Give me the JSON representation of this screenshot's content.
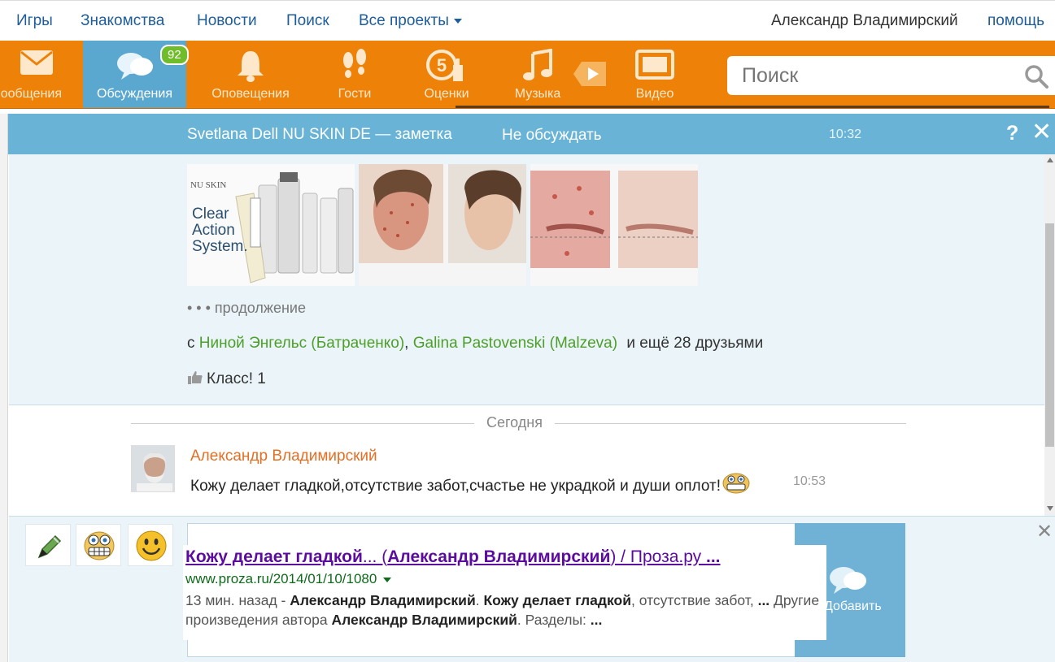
{
  "nav": {
    "links": [
      "Игры",
      "Знакомства",
      "Новости",
      "Поиск",
      "Все проекты"
    ],
    "user": "Александр Владимирский",
    "help": "помощь"
  },
  "toolbar": {
    "items": [
      {
        "label": "ообщения",
        "icon": "envelope-icon"
      },
      {
        "label": "Обсуждения",
        "icon": "chat-bubbles-icon",
        "badge": "92",
        "active": true
      },
      {
        "label": "Оповещения",
        "icon": "bell-icon"
      },
      {
        "label": "Гости",
        "icon": "footprints-icon"
      },
      {
        "label": "Оценки",
        "icon": "rating-5-icon"
      },
      {
        "label": "Музыка",
        "icon": "music-note-icon"
      },
      {
        "label": "Видео",
        "icon": "video-icon"
      }
    ],
    "search_placeholder": "Поиск"
  },
  "discussion": {
    "title": "Svetlana Dell NU SKIN DE — заметка",
    "no_discuss": "Не обсуждать",
    "time": "10:32",
    "help": "?",
    "close": "✕",
    "images": {
      "img1_lines": [
        "Clear",
        "Action",
        "System."
      ],
      "img1_brand": "NU SKIN"
    },
    "more": "• • •  продолжение",
    "friends_prefix": "с ",
    "friend1": "Ниной Энгельс (Батраченко)",
    "sep": ", ",
    "friend2": "Galina Pastovenski (Malzeva)",
    "friends_suffix": " и ещё 28 друзьями",
    "klass": "Класс! 1",
    "day_divider": "Сегодня",
    "message": {
      "author": "Александр Владимирский",
      "text": "Кожу делает гладкой,отсутствие забот,счастье не украдкой и души оплот!",
      "time": "10:53"
    }
  },
  "composer": {
    "send_label": "Добавить",
    "close": "✕",
    "snippet": {
      "title_a": "Кожу делает гладкой",
      "title_b": "... (",
      "title_c": "Александр Владимирский",
      "title_d": ") / Проза.ру ",
      "title_e": "...",
      "url": "www.proza.ru/2014/01/10/1080",
      "desc_1": "13 мин. назад - ",
      "desc_2": "Александр Владимирский",
      "desc_3": ". ",
      "desc_4": "Кожу делает гладкой",
      "desc_5": ", отсутствие забот, ",
      "desc_6": "...",
      "desc_7": " Другие произведения автора ",
      "desc_8": "Александр Владимирский",
      "desc_9": ". Разделы: ",
      "desc_10": "..."
    }
  },
  "colors": {
    "toolbar": "#ee8208",
    "active_tab": "#5aa8d0",
    "header": "#69b4d6",
    "link": "#1d5d9b",
    "friend_link": "#4d9f2a",
    "author": "#e36f24"
  }
}
